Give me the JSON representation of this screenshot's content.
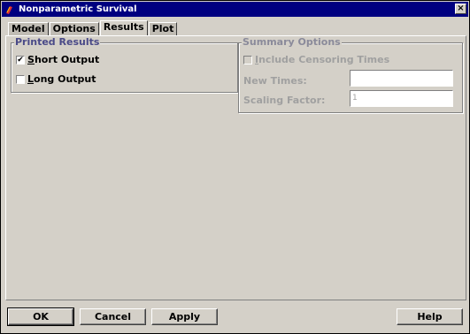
{
  "window": {
    "title": "Nonparametric Survival",
    "close_glyph": "×"
  },
  "tabs": [
    {
      "label": "Model",
      "active": false
    },
    {
      "label": "Options",
      "active": false
    },
    {
      "label": "Results",
      "active": true
    },
    {
      "label": "Plot",
      "active": false
    }
  ],
  "printed_results": {
    "legend": "Printed Results",
    "short_output": {
      "label_first": "S",
      "label_rest": "hort Output",
      "checked": true,
      "check_glyph": "✔"
    },
    "long_output": {
      "label_first": "L",
      "label_rest": "ong Output",
      "checked": false
    }
  },
  "summary_options": {
    "legend": "Summary Options",
    "include_censoring": {
      "label_first": "I",
      "label_rest": "nclude Censoring Times",
      "checked": false
    },
    "new_times": {
      "label": "New Times:",
      "value": ""
    },
    "scaling_factor": {
      "label": "Scaling Factor:",
      "value": "1"
    }
  },
  "buttons": {
    "ok": "OK",
    "cancel": "Cancel",
    "apply": "Apply",
    "help": "Help"
  }
}
